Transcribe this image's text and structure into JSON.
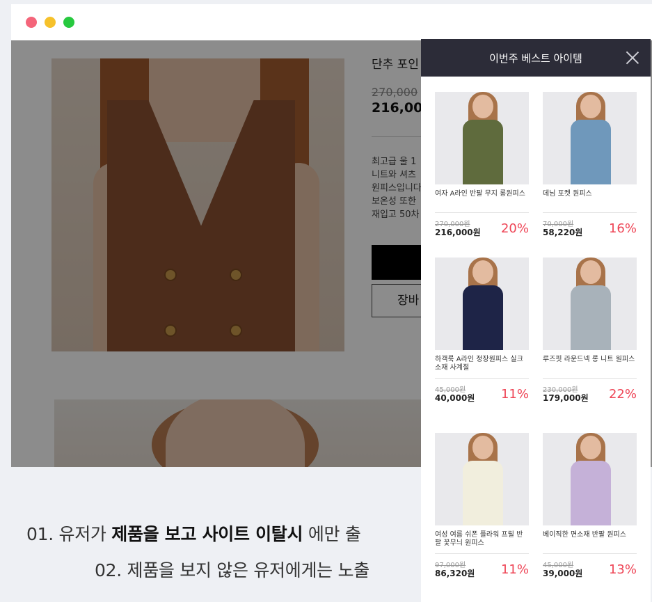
{
  "window": {
    "controls": [
      "close",
      "minimize",
      "maximize"
    ]
  },
  "product": {
    "title": "단추 포인",
    "original_price": "270,000",
    "sale_price": "216,00",
    "description_lines": [
      "최고급 울 1",
      "니트와 셔츠",
      "원피스입니다",
      "보온성 또한",
      "재입고 50차"
    ],
    "cart_label": "장바"
  },
  "popup": {
    "title": "이번주 베스트 아이템",
    "items": [
      {
        "name": "여자 A라인 반팔 무지 롱원피스",
        "original": "270,000원",
        "sale": "216,000원",
        "discount": "20%",
        "color": "#5f6b3d"
      },
      {
        "name": "데님 포켓 원피스",
        "original": "70,000원",
        "sale": "58,220원",
        "discount": "16%",
        "color": "#6f98bb"
      },
      {
        "name": "하객룩 A라인 정장원피스 실크소재 사계절",
        "original": "45,000원",
        "sale": "40,000원",
        "discount": "11%",
        "color": "#1e2447"
      },
      {
        "name": "루즈핏 라운드넥 롱 니트 원피스",
        "original": "230,000원",
        "sale": "179,000원",
        "discount": "22%",
        "color": "#a8b2ba"
      },
      {
        "name": "여성 여름 쉬폰 플라워 프릴 반팔 꽃무늬 원피스",
        "original": "97,000원",
        "sale": "86,320원",
        "discount": "11%",
        "color": "#f1eedd"
      },
      {
        "name": "베이직한 면소재 반팔 원피스",
        "original": "45,000원",
        "sale": "39,000원",
        "discount": "13%",
        "color": "#c5b1d8"
      }
    ]
  },
  "captions": {
    "line1_prefix": "01. 유저가 ",
    "line1_bold": "제품을 보고 사이트 이탈시",
    "line1_suffix": " 에만 출",
    "line2": "02. 제품을 보지 않은 유저에게는 노출"
  },
  "colors": {
    "accent_discount": "#ee4455",
    "popup_header": "#2c2c38"
  }
}
